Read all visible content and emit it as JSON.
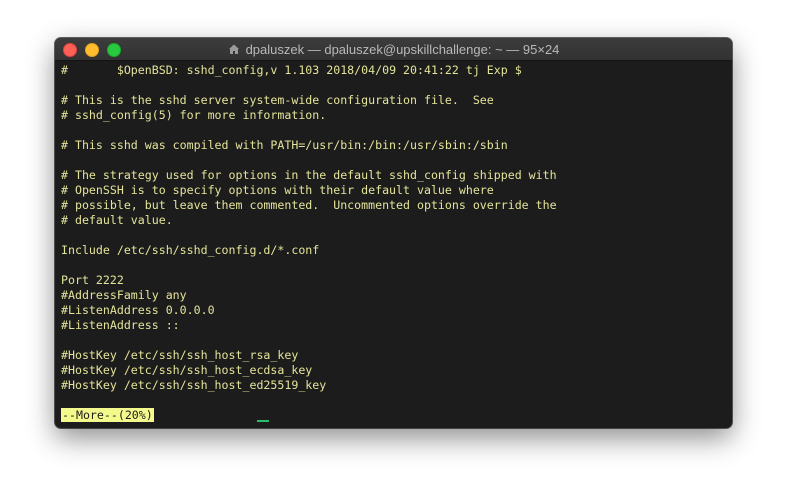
{
  "window": {
    "title": "dpaluszek — dpaluszek@upskillchallenge: ~ — 95×24"
  },
  "terminal": {
    "lines": [
      "#\t$OpenBSD: sshd_config,v 1.103 2018/04/09 20:41:22 tj Exp $",
      "",
      "# This is the sshd server system-wide configuration file.  See",
      "# sshd_config(5) for more information.",
      "",
      "# This sshd was compiled with PATH=/usr/bin:/bin:/usr/sbin:/sbin",
      "",
      "# The strategy used for options in the default sshd_config shipped with",
      "# OpenSSH is to specify options with their default value where",
      "# possible, but leave them commented.  Uncommented options override the",
      "# default value.",
      "",
      "Include /etc/ssh/sshd_config.d/*.conf",
      "",
      "Port 2222",
      "#AddressFamily any",
      "#ListenAddress 0.0.0.0",
      "#ListenAddress ::",
      "",
      "#HostKey /etc/ssh/ssh_host_rsa_key",
      "#HostKey /etc/ssh/ssh_host_ecdsa_key",
      "#HostKey /etc/ssh/ssh_host_ed25519_key",
      ""
    ],
    "pager_prompt": "--More--(20%)"
  },
  "colors": {
    "text": "#e4e49a",
    "background": "#1c1c1c",
    "prompt_highlight": "#f4f98c",
    "cursor": "#2bbd6a"
  }
}
